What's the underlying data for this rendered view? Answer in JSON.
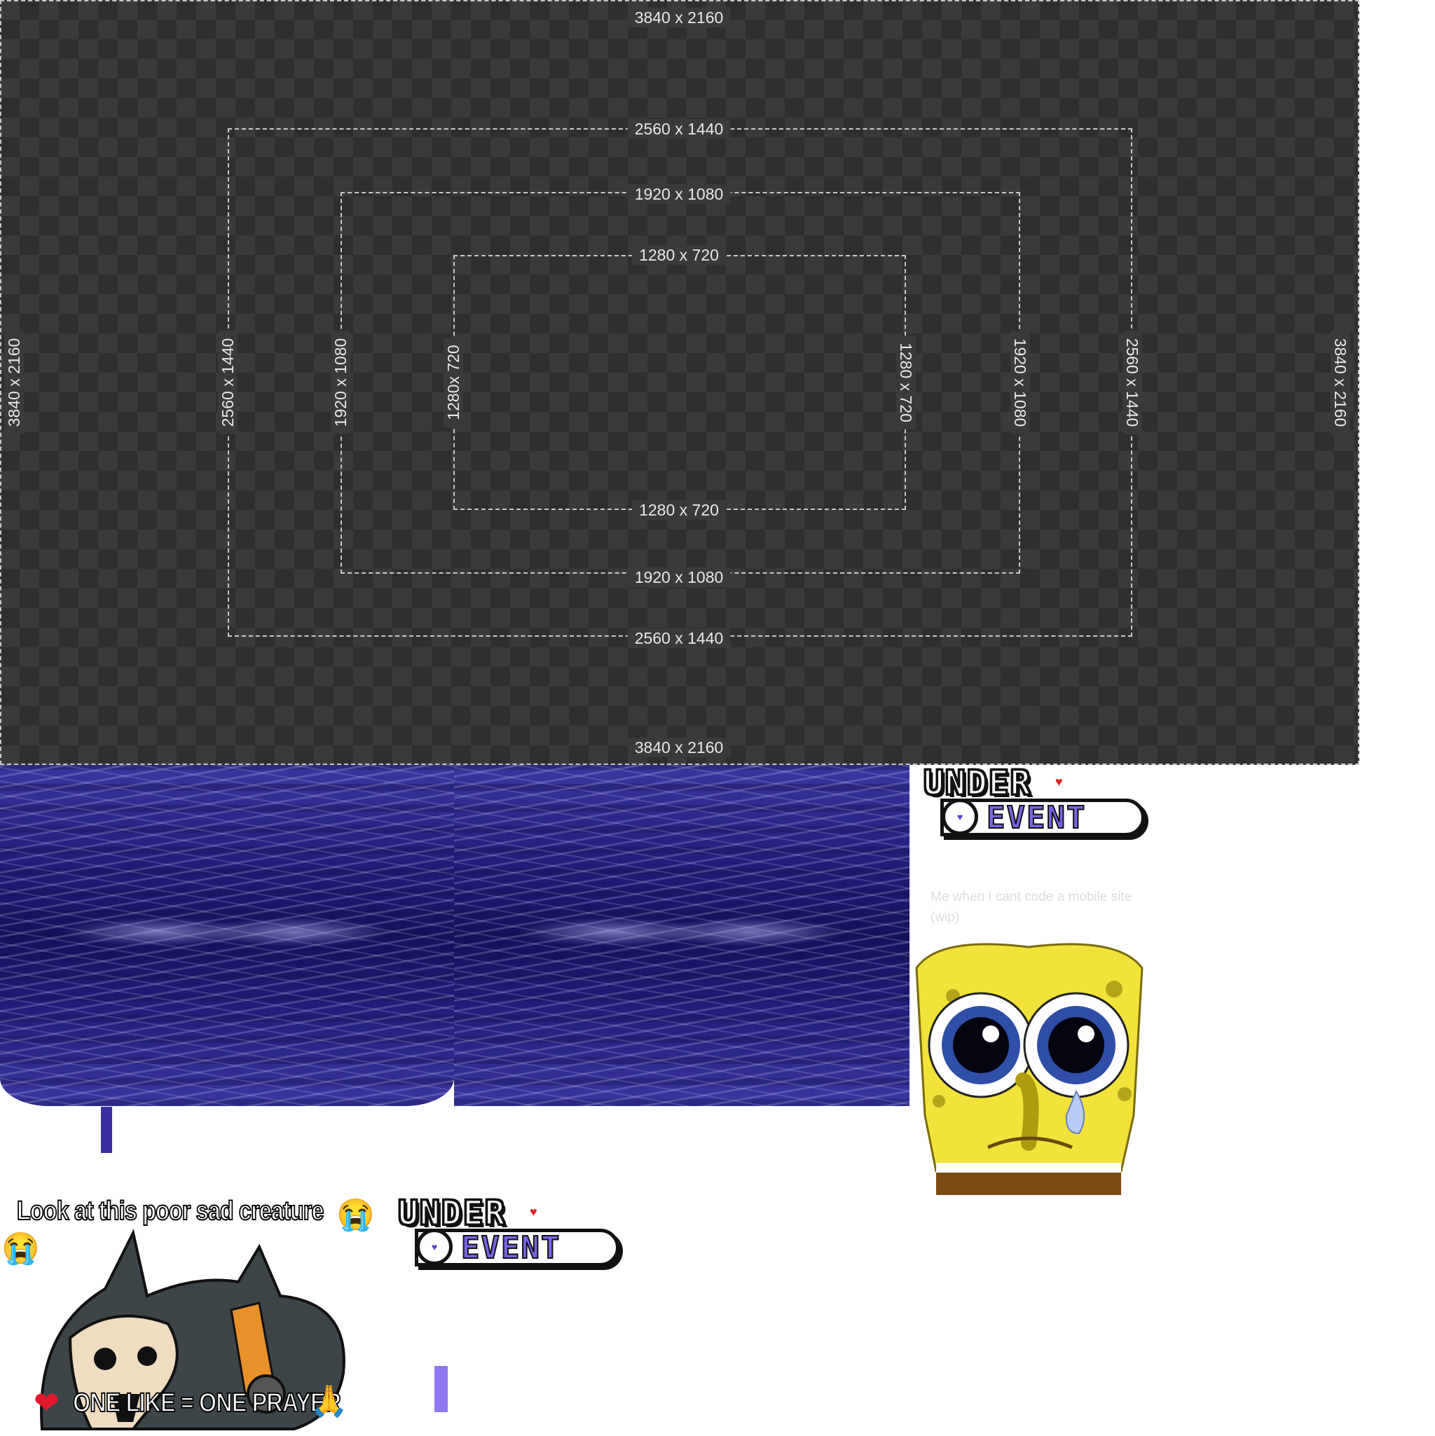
{
  "guide": {
    "outer_top": "3840 x 2160",
    "outer_bottom": "3840 x 2160",
    "outer_left": "3840 x 2160",
    "outer_right": "3840 x 2160",
    "qhd_top": "2560 x 1440",
    "qhd_bottom": "2560 x 1440",
    "qhd_left": "2560 x 1440",
    "qhd_right": "2560 x 1440",
    "fhd_top": "1920 x 1080",
    "fhd_bottom": "1920 x 1080",
    "fhd_left": "1920 x 1080",
    "fhd_right": "1920 x 1080",
    "hd_top": "1280 x 720",
    "hd_bottom": "1280 x 720",
    "hd_left": "1280x 720",
    "hd_right": "1280 x 720"
  },
  "logo": {
    "line1": "UNDER",
    "line2": "EVENT"
  },
  "caption": "Me when I cant code a mobile site (wip)",
  "meme": {
    "top_text": "Look at this poor sad creature",
    "bottom_text": "ONE LIKE = ONE PRAYER"
  },
  "colors": {
    "accent": "#7a63e8",
    "guide_bg": "#3a3a3a",
    "water": "#201c78"
  }
}
